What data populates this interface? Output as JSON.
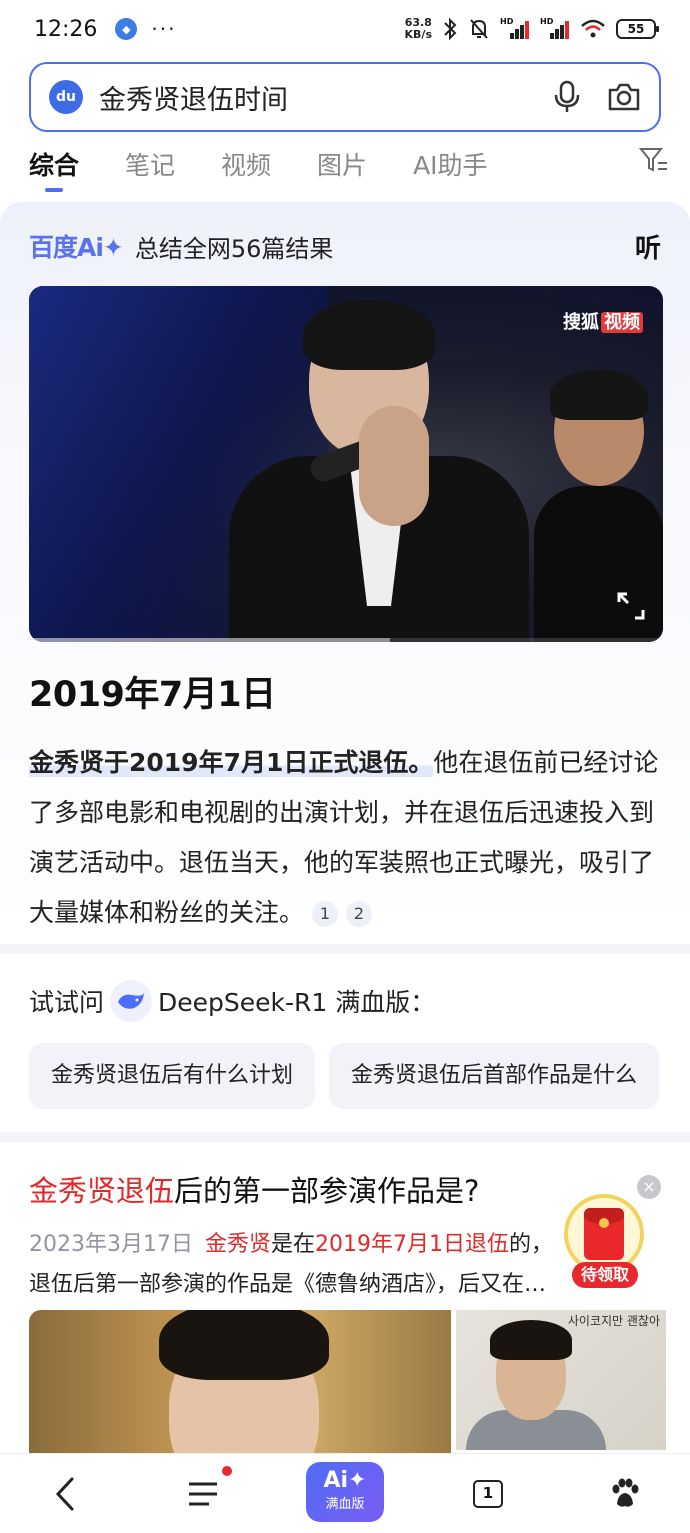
{
  "status_bar": {
    "time": "12:26",
    "more": "···",
    "net_speed": "63.8",
    "net_unit": "KB/s",
    "battery": "55",
    "hd1": "HD",
    "hd2": "HD"
  },
  "search": {
    "logo": "du",
    "query": "金秀贤退伍时间"
  },
  "tabs": [
    "综合",
    "笔记",
    "视频",
    "图片",
    "AI助手"
  ],
  "ai_summary": {
    "logo_text": "百度",
    "logo_ai": "Ai✦",
    "summary_label": "总结全网56篇结果",
    "listen_label": "听",
    "video_watermark": "搜狐",
    "video_watermark_tag": "视频",
    "answer_title": "2019年7月1日",
    "answer_highlight": "金秀贤于2019年7月1日正式退伍。",
    "answer_body": "他在退伍前已经讨论了多部电影和电视剧的出演计划，并在退伍后迅速投入到演艺活动中。退伍当天，他的军装照也正式曝光，吸引了大量媒体和粉丝的关注。",
    "citations": [
      "1",
      "2"
    ],
    "video_progress": 0.57
  },
  "try_ask": {
    "prefix": "试试问",
    "model": "DeepSeek-R1 满血版：",
    "suggestions": [
      "金秀贤退伍后有什么计划",
      "金秀贤退伍后首部作品是什么"
    ]
  },
  "result": {
    "title_red": "金秀贤退伍",
    "title_rest": "后的第一部参演作品是?",
    "date": "2023年3月17日",
    "meta_red1": "金秀贤",
    "meta_mid": "是在",
    "meta_red2": "2019年7月1日退伍",
    "meta_tail": "的，",
    "snippet": "退伍后第一部参演的作品是《德鲁纳酒店》，后又在…",
    "thumb2_title": "사이코지만 괜찮아",
    "redpack_label": "待领取",
    "close": "×"
  },
  "bottom_nav": {
    "ai_big": "Ai✦",
    "ai_small": "满血版",
    "tab_count": "1"
  },
  "colors": {
    "accent": "#4e6ef2",
    "red": "#e02a2a"
  }
}
